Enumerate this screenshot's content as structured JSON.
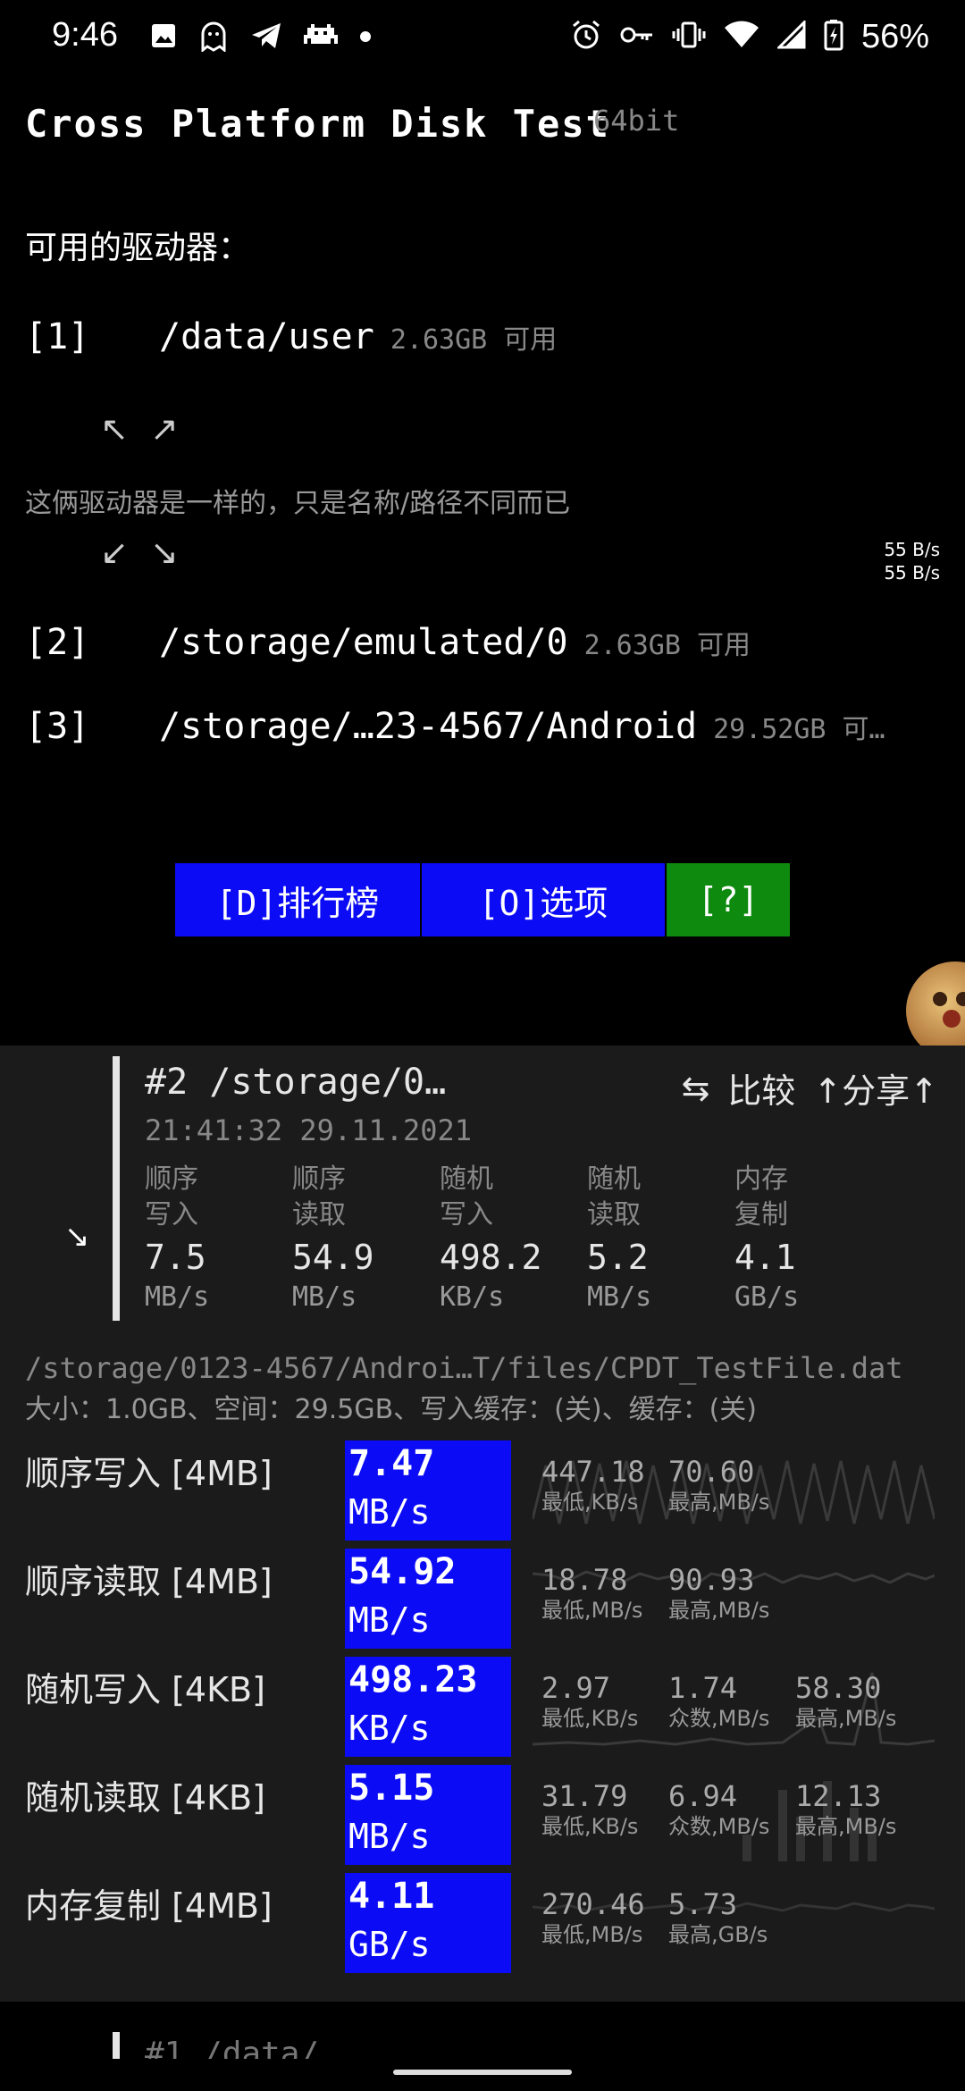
{
  "status_bar": {
    "time": "9:46",
    "battery": "56%",
    "left_icons": [
      "image-icon",
      "ghost-icon",
      "telegram-icon",
      "space-invader-icon",
      "dot-icon"
    ],
    "right_icons": [
      "alarm-icon",
      "key-icon",
      "vibrate-icon",
      "wifi-icon",
      "signal-icon",
      "battery-charging-icon"
    ]
  },
  "header": {
    "title": "Cross Platform Disk Test",
    "bits": "64bit"
  },
  "drives_label": "可用的驱动器：",
  "drives": [
    {
      "index": "[1]",
      "path": "/data/user",
      "free": "2.63GB 可用"
    },
    {
      "index": "[2]",
      "path": "/storage/emulated/0",
      "free": "2.63GB 可用"
    },
    {
      "index": "[3]",
      "path": "/storage/…23-4567/Android",
      "free": "29.52GB 可…"
    }
  ],
  "same_drive_note": "这俩驱动器是一样的，只是名称/路径不同而已",
  "speed_indicator": {
    "line1": "55 B/s",
    "line2": "55 B/s"
  },
  "buttons": {
    "ranking": "[D]排行榜",
    "options": "[O]选项",
    "help": "[?]"
  },
  "result_card": {
    "title": "#2 /storage/0…",
    "compare": "比较",
    "share": "↑分享↑",
    "date": "21:41:32 29.11.2021",
    "summary": [
      {
        "label1": "顺序",
        "label2": "写入",
        "value": "7.5",
        "unit": "MB/s"
      },
      {
        "label1": "顺序",
        "label2": "读取",
        "value": "54.9",
        "unit": "MB/s"
      },
      {
        "label1": "随机",
        "label2": "写入",
        "value": "498.2",
        "unit": "KB/s"
      },
      {
        "label1": "随机",
        "label2": "读取",
        "value": "5.2",
        "unit": "MB/s"
      },
      {
        "label1": "内存",
        "label2": "复制",
        "value": "4.1",
        "unit": "GB/s"
      }
    ]
  },
  "file_path": "/storage/0123-4567/Androi…T/files/CPDT_TestFile.dat",
  "file_info": "大小：1.0GB、空间：29.5GB、写入缓存：(关)、缓存：(关)",
  "results": [
    {
      "label": "顺序写入 [4MB]",
      "value": "7.47",
      "unit": "MB/s",
      "stats": [
        {
          "value": "447.18",
          "label": "最低,KB/s"
        },
        {
          "value": "70.60",
          "label": "最高,MB/s"
        }
      ]
    },
    {
      "label": "顺序读取 [4MB]",
      "value": "54.92",
      "unit": "MB/s",
      "stats": [
        {
          "value": "18.78",
          "label": "最低,MB/s"
        },
        {
          "value": "90.93",
          "label": "最高,MB/s"
        }
      ]
    },
    {
      "label": "随机写入 [4KB]",
      "value": "498.23",
      "unit": "KB/s",
      "stats": [
        {
          "value": "2.97",
          "label": "最低,KB/s"
        },
        {
          "value": "1.74",
          "label": "众数,MB/s"
        },
        {
          "value": "58.30",
          "label": "最高,MB/s"
        }
      ]
    },
    {
      "label": "随机读取 [4KB]",
      "value": "5.15",
      "unit": "MB/s",
      "stats": [
        {
          "value": "31.79",
          "label": "最低,KB/s"
        },
        {
          "value": "6.94",
          "label": "众数,MB/s"
        },
        {
          "value": "12.13",
          "label": "最高,MB/s"
        }
      ]
    },
    {
      "label": "内存复制 [4MB]",
      "value": "4.11",
      "unit": "GB/s",
      "stats": [
        {
          "value": "270.46",
          "label": "最低,MB/s"
        },
        {
          "value": "5.73",
          "label": "最高,GB/s"
        }
      ]
    }
  ],
  "next_card_peek": "#1 /data/..."
}
